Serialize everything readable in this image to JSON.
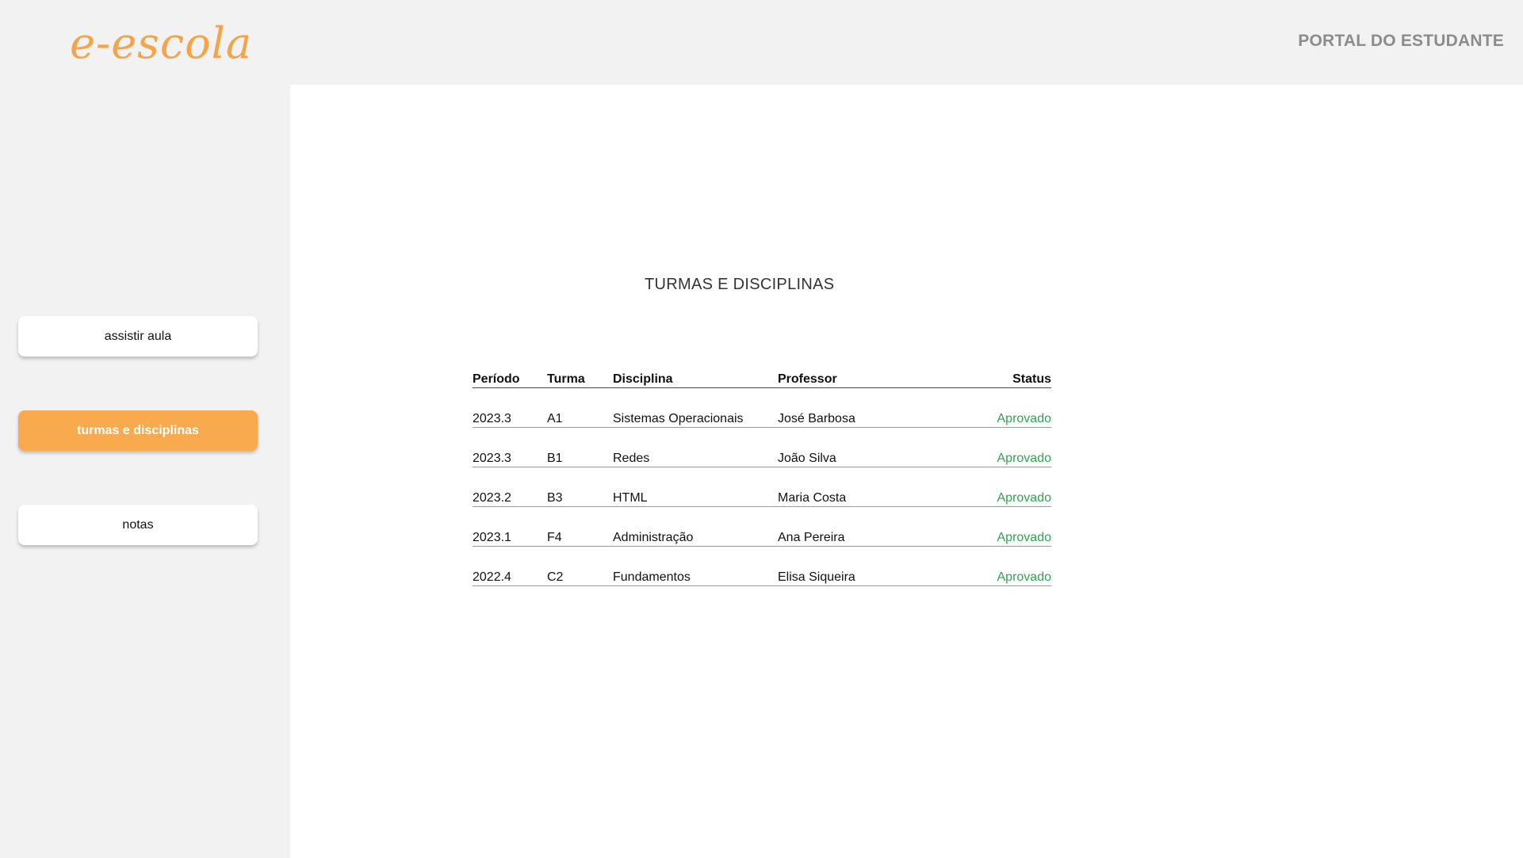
{
  "header": {
    "logo_text": "e-escola",
    "portal_title": "PORTAL DO ESTUDANTE"
  },
  "sidebar": {
    "items": [
      {
        "label": "assistir aula",
        "active": false
      },
      {
        "label": "turmas e disciplinas",
        "active": true
      },
      {
        "label": "notas",
        "active": false
      }
    ]
  },
  "main": {
    "title": "TURMAS E DISCIPLINAS",
    "table": {
      "headers": [
        "Período",
        "Turma",
        "Disciplina",
        "Professor",
        "Status"
      ],
      "rows": [
        [
          "2023.3",
          "A1",
          "Sistemas Operacionais",
          "José Barbosa",
          "Aprovado"
        ],
        [
          "2023.3",
          "B1",
          "Redes",
          "João Silva",
          "Aprovado"
        ],
        [
          "2023.2",
          "B3",
          "HTML",
          "Maria Costa",
          "Aprovado"
        ],
        [
          "2023.1",
          "F4",
          "Administração",
          "Ana Pereira",
          "Aprovado"
        ],
        [
          "2022.4",
          "C2",
          "Fundamentos",
          "Elisa Siqueira",
          "Aprovado"
        ]
      ]
    }
  },
  "colors": {
    "accent": "#f9aa4e",
    "logo": "#f7a448",
    "status_approved": "#2ea44f",
    "background": "#f2f2f2"
  }
}
